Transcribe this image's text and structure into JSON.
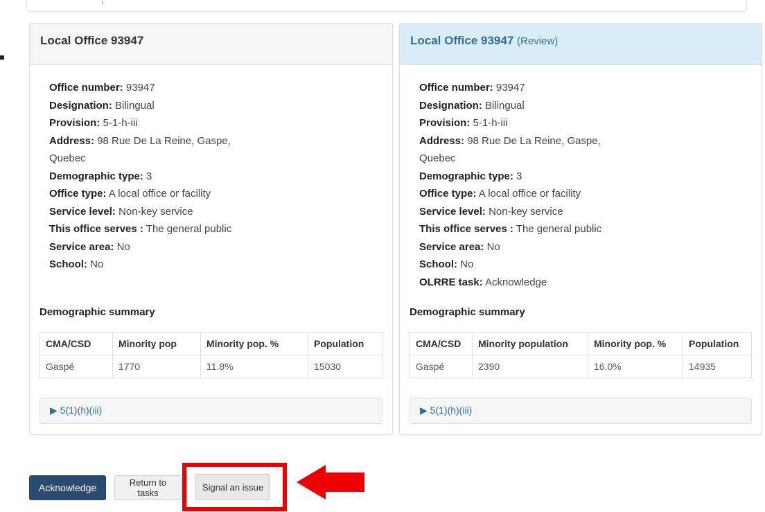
{
  "left_panel": {
    "title": "Local Office 93947",
    "details": [
      {
        "label": "Office number:",
        "value": " 93947"
      },
      {
        "label": "Designation:",
        "value": " Bilingual"
      },
      {
        "label": "Provision:",
        "value": " 5-1-h-iii"
      },
      {
        "label": "Address:",
        "value": " 98 Rue De La Reine, Gaspe, Quebec"
      },
      {
        "label": "Demographic type:",
        "value": " 3"
      },
      {
        "label": "Office type:",
        "value": " A local office or facility"
      },
      {
        "label": "Service level:",
        "value": " Non-key service"
      },
      {
        "label": "This office serves :",
        "value": " The general public"
      },
      {
        "label": "Service area:",
        "value": " No"
      },
      {
        "label": "School:",
        "value": " No"
      }
    ],
    "demographic_title": "Demographic summary",
    "table_headers": [
      "CMA/CSD",
      "Minority pop",
      "Minority pop. %",
      "Population"
    ],
    "table_row": [
      "Gaspé",
      "1770",
      "11.8%",
      "15030"
    ],
    "collapse_label": "5(1)(h)(iii)"
  },
  "right_panel": {
    "title": "Local Office 93947",
    "title_suffix": "(Review)",
    "details": [
      {
        "label": "Office number:",
        "value": " 93947"
      },
      {
        "label": "Designation:",
        "value": " Bilingual"
      },
      {
        "label": "Provision:",
        "value": " 5-1-h-iii"
      },
      {
        "label": "Address:",
        "value": " 98 Rue De La Reine, Gaspe, Quebec"
      },
      {
        "label": "Demographic type:",
        "value": " 3"
      },
      {
        "label": "Office type:",
        "value": " A local office or facility"
      },
      {
        "label": "Service level:",
        "value": " Non-key service"
      },
      {
        "label": "This office serves :",
        "value": " The general public"
      },
      {
        "label": "Service area:",
        "value": " No"
      },
      {
        "label": "School:",
        "value": " No"
      },
      {
        "label": "OLRRE task:",
        "value": " Acknowledge"
      }
    ],
    "demographic_title": "Demographic summary",
    "table_headers": [
      "CMA/CSD",
      "Minority population",
      "Minority pop. %",
      "Population"
    ],
    "table_row": [
      "Gaspé",
      "2390",
      "16.0%",
      "14935"
    ],
    "collapse_label": "5(1)(h)(iii)"
  },
  "actions": {
    "acknowledge": "Acknowledge",
    "return": "Return to tasks",
    "signal": "Signal an issue"
  },
  "colors": {
    "primary": "#2b4a6f",
    "review_heading_bg": "#d9edf7",
    "review_heading_text": "#31708f",
    "annotation_red": "#ee0000"
  },
  "icons": {
    "collapse": "triangle-right-icon",
    "annotation_arrow": "arrow-left-icon"
  }
}
